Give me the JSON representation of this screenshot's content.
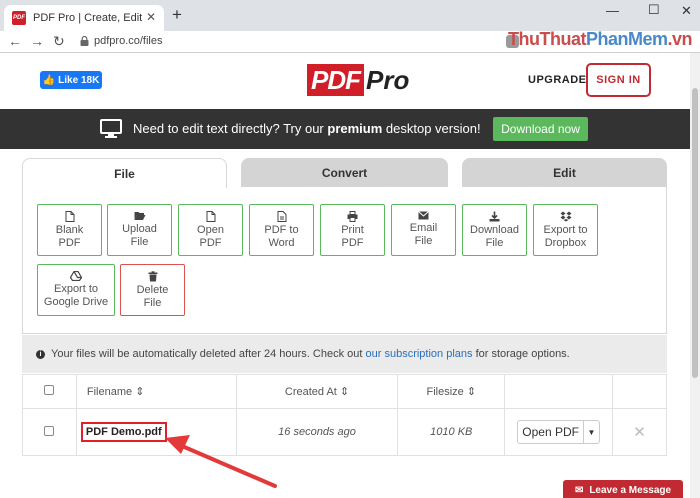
{
  "browser": {
    "tab_title": "PDF Pro | Create, Edit & Convert",
    "favicon_text": "PDF",
    "url": "pdfpro.co/files",
    "watermark_a": "ThuThuat",
    "watermark_b": "PhanMem",
    "watermark_c": ".vn"
  },
  "header": {
    "like_label": "Like 18K",
    "logo_pdf": "PDF",
    "logo_pro": "Pro",
    "upgrade_label": "UPGRADE",
    "signin_label": "SIGN IN"
  },
  "banner": {
    "text_before": "Need to edit text directly? Try our ",
    "text_bold": "premium",
    "text_after": " desktop version!",
    "download_label": "Download now"
  },
  "tabs": [
    {
      "label": "File",
      "active": true
    },
    {
      "label": "Convert",
      "active": false
    },
    {
      "label": "Edit",
      "active": false
    }
  ],
  "tools": [
    {
      "line1": "Blank",
      "line2": "PDF",
      "icon": "file-icon"
    },
    {
      "line1": "Upload",
      "line2": "File",
      "icon": "folder-open-icon"
    },
    {
      "line1": "Open",
      "line2": "PDF",
      "icon": "file-icon"
    },
    {
      "line1": "PDF to",
      "line2": "Word",
      "icon": "file-text-icon"
    },
    {
      "line1": "Print",
      "line2": "PDF",
      "icon": "print-icon"
    },
    {
      "line1": "Email",
      "line2": "File",
      "icon": "envelope-icon"
    },
    {
      "line1": "Download",
      "line2": "File",
      "icon": "download-icon"
    },
    {
      "line1": "Export to",
      "line2": "Dropbox",
      "icon": "dropbox-icon"
    },
    {
      "line1": "Export to",
      "line2": "Google Drive",
      "icon": "google-drive-icon"
    },
    {
      "line1": "Delete",
      "line2": "File",
      "icon": "trash-icon"
    }
  ],
  "info": {
    "icon": "i",
    "text_before": "Your files will be automatically deleted after 24 hours. Check out ",
    "link": "our subscription plans",
    "text_after": " for storage options."
  },
  "table": {
    "headers": {
      "filename": "Filename",
      "created_at": "Created At",
      "filesize": "Filesize"
    },
    "rows": [
      {
        "filename": "PDF Demo.pdf",
        "created_at": "16 seconds ago",
        "filesize": "1010 KB",
        "action": "Open PDF"
      }
    ]
  },
  "leave_message": "Leave a Message",
  "colors": {
    "brand_red": "#d11f2a",
    "green": "#5cb85c",
    "banner_bg": "#333333",
    "annotation_red": "#e0202a"
  }
}
